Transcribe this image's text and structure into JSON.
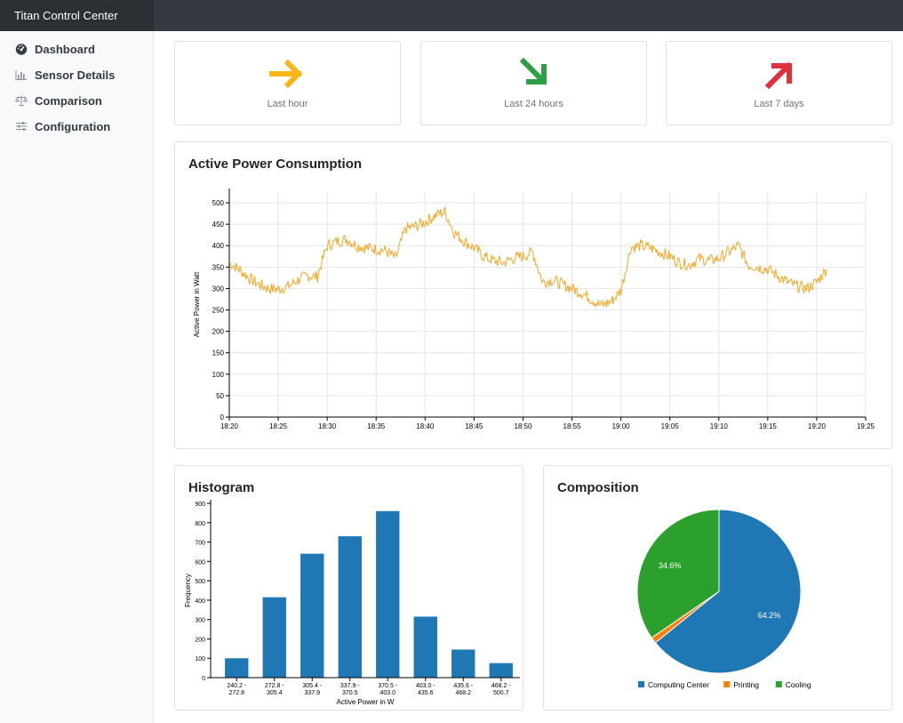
{
  "app": {
    "title": "Titan Control Center"
  },
  "sidebar": {
    "items": [
      {
        "label": "Dashboard",
        "icon": "gauge-icon"
      },
      {
        "label": "Sensor Details",
        "icon": "bar-chart-icon"
      },
      {
        "label": "Comparison",
        "icon": "scale-icon"
      },
      {
        "label": "Configuration",
        "icon": "sliders-icon"
      }
    ]
  },
  "trends": [
    {
      "label": "Last hour",
      "direction": "right",
      "color": "#f7b516"
    },
    {
      "label": "Last 24 hours",
      "direction": "down-right",
      "color": "#2ea043"
    },
    {
      "label": "Last 7 days",
      "direction": "up-right",
      "color": "#e0313f"
    }
  ],
  "power_chart": {
    "title": "Active Power Consumption",
    "ylabel": "Active Power in Watt",
    "color": "#f5a623",
    "chart_data": {
      "type": "line",
      "xlim": [
        "18:20",
        "19:25"
      ],
      "ylim": [
        0,
        525
      ],
      "x_ticks": [
        "18:20",
        "18:25",
        "18:30",
        "18:35",
        "18:40",
        "18:45",
        "18:50",
        "18:55",
        "19:00",
        "19:05",
        "19:10",
        "19:15",
        "19:20",
        "19:25"
      ],
      "y_ticks": [
        0,
        50,
        100,
        150,
        200,
        250,
        300,
        350,
        400,
        450,
        500
      ],
      "series": [
        {
          "x": [
            "18:20",
            "18:21",
            "18:22",
            "18:23",
            "18:24",
            "18:25",
            "18:26",
            "18:27",
            "18:28",
            "18:29",
            "18:30",
            "18:31",
            "18:32",
            "18:33",
            "18:34",
            "18:35",
            "18:36",
            "18:37",
            "18:38",
            "18:39",
            "18:40",
            "18:41",
            "18:42",
            "18:43",
            "18:44",
            "18:45",
            "18:46",
            "18:47",
            "18:48",
            "18:49",
            "18:50",
            "18:51",
            "18:52",
            "18:53",
            "18:54",
            "18:55",
            "18:56",
            "18:57",
            "18:58",
            "18:59",
            "19:00",
            "19:01",
            "19:02",
            "19:03",
            "19:04",
            "19:05",
            "19:06",
            "19:07",
            "19:08",
            "19:09",
            "19:10",
            "19:11",
            "19:12",
            "19:13",
            "19:14",
            "19:15",
            "19:16",
            "19:17",
            "19:18",
            "19:19",
            "19:20",
            "19:21"
          ],
          "values": [
            360,
            345,
            325,
            310,
            300,
            298,
            305,
            320,
            330,
            328,
            400,
            410,
            415,
            400,
            395,
            392,
            388,
            370,
            440,
            445,
            455,
            470,
            480,
            430,
            410,
            395,
            375,
            365,
            360,
            370,
            375,
            385,
            315,
            320,
            310,
            300,
            290,
            275,
            260,
            270,
            295,
            395,
            400,
            395,
            385,
            375,
            360,
            355,
            370,
            365,
            370,
            385,
            400,
            355,
            350,
            345,
            330,
            315,
            305,
            300,
            315,
            345
          ]
        }
      ]
    }
  },
  "histogram": {
    "title": "Histogram",
    "xlabel": "Active Power in W",
    "ylabel": "Frequency",
    "color": "#1f77b4",
    "chart_data": {
      "type": "bar",
      "categories": [
        [
          "240.2 -",
          "272.8"
        ],
        [
          "272.8 -",
          "305.4"
        ],
        [
          "305.4 -",
          "337.9"
        ],
        [
          "337.9 -",
          "370.5"
        ],
        [
          "370.5 -",
          "403.0"
        ],
        [
          "403.0 -",
          "435.6"
        ],
        [
          "435.6 -",
          "468.2"
        ],
        [
          "468.2 -",
          "500.7"
        ]
      ],
      "values": [
        100,
        415,
        640,
        730,
        860,
        315,
        145,
        75
      ],
      "ylim": [
        0,
        900
      ],
      "y_ticks": [
        0,
        100,
        200,
        300,
        400,
        500,
        600,
        700,
        800,
        900
      ]
    }
  },
  "composition": {
    "title": "Composition",
    "chart_data": {
      "type": "pie",
      "slices": [
        {
          "name": "Computing Center",
          "value": 64.2,
          "label": "64.2%",
          "color": "#1f77b4"
        },
        {
          "name": "Printing",
          "value": 1.2,
          "label": "",
          "color": "#ff7f0e"
        },
        {
          "name": "Cooling",
          "value": 34.6,
          "label": "34.6%",
          "color": "#2ca02c"
        }
      ]
    }
  }
}
